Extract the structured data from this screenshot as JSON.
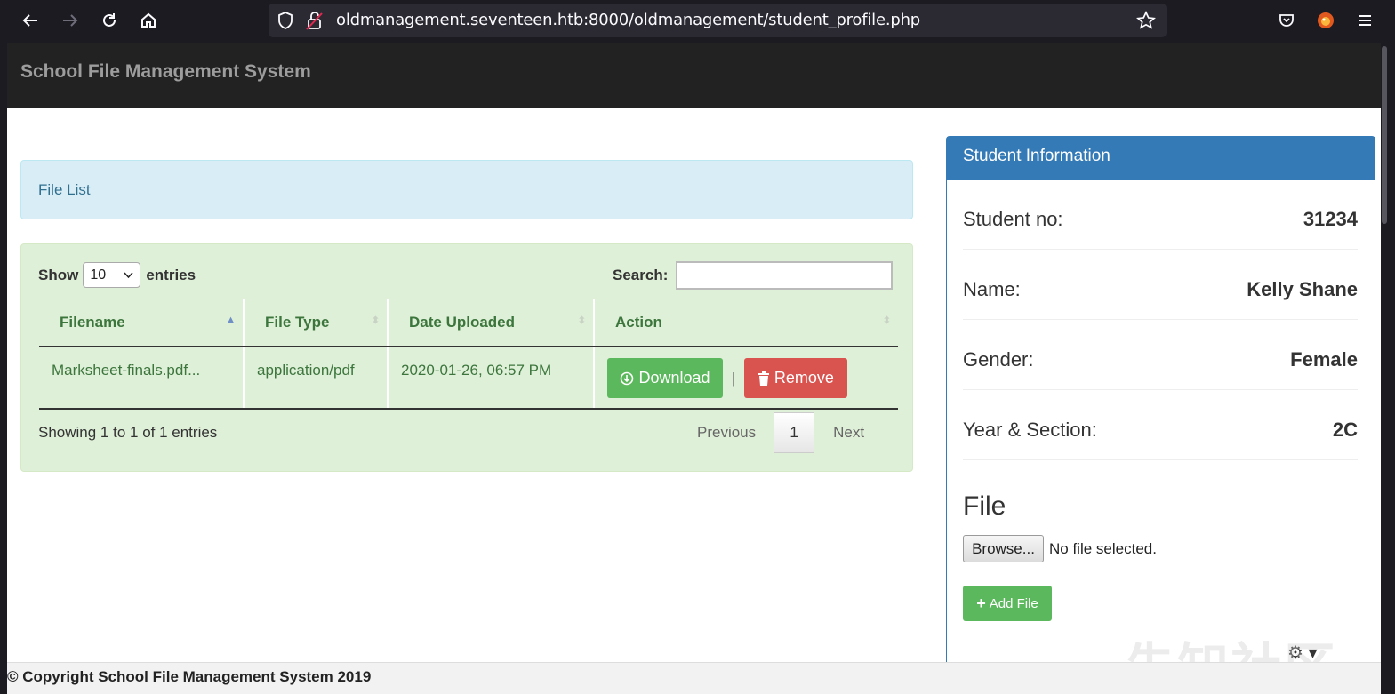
{
  "browser": {
    "url": "oldmanagement.seventeen.htb:8000/oldmanagement/student_profile.php"
  },
  "app": {
    "brand": "School File Management System"
  },
  "file_list": {
    "title": "File List",
    "show_label": "Show",
    "entries_value": "10",
    "entries_label": "entries",
    "search_label": "Search:",
    "columns": [
      "Filename",
      "File Type",
      "Date Uploaded",
      "Action"
    ],
    "rows": [
      {
        "filename": "Marksheet-finals.pdf...",
        "file_type": "application/pdf",
        "date_uploaded": "2020-01-26, 06:57 PM",
        "download_label": "Download",
        "remove_label": "Remove",
        "separator": "|"
      }
    ],
    "info": "Showing 1 to 1 of 1 entries",
    "pagination": {
      "previous": "Previous",
      "current_page": "1",
      "next": "Next"
    }
  },
  "student": {
    "heading": "Student Information",
    "fields": [
      {
        "label": "Student no:",
        "value": "31234"
      },
      {
        "label": "Name:",
        "value": "Kelly Shane"
      },
      {
        "label": "Gender:",
        "value": "Female"
      },
      {
        "label": "Year & Section:",
        "value": "2C"
      }
    ],
    "file_heading": "File",
    "browse_label": "Browse...",
    "no_file_text": "No file selected.",
    "add_file_label": "Add File"
  },
  "footer": {
    "text": "© Copyright School File Management System 2019"
  },
  "watermark": "先知社区",
  "colors": {
    "navbar": "#222222",
    "primary": "#337ab7",
    "success": "#5cb85c",
    "danger": "#d9534f",
    "info_bg": "#d9edf7",
    "success_bg": "#dff0d8"
  }
}
